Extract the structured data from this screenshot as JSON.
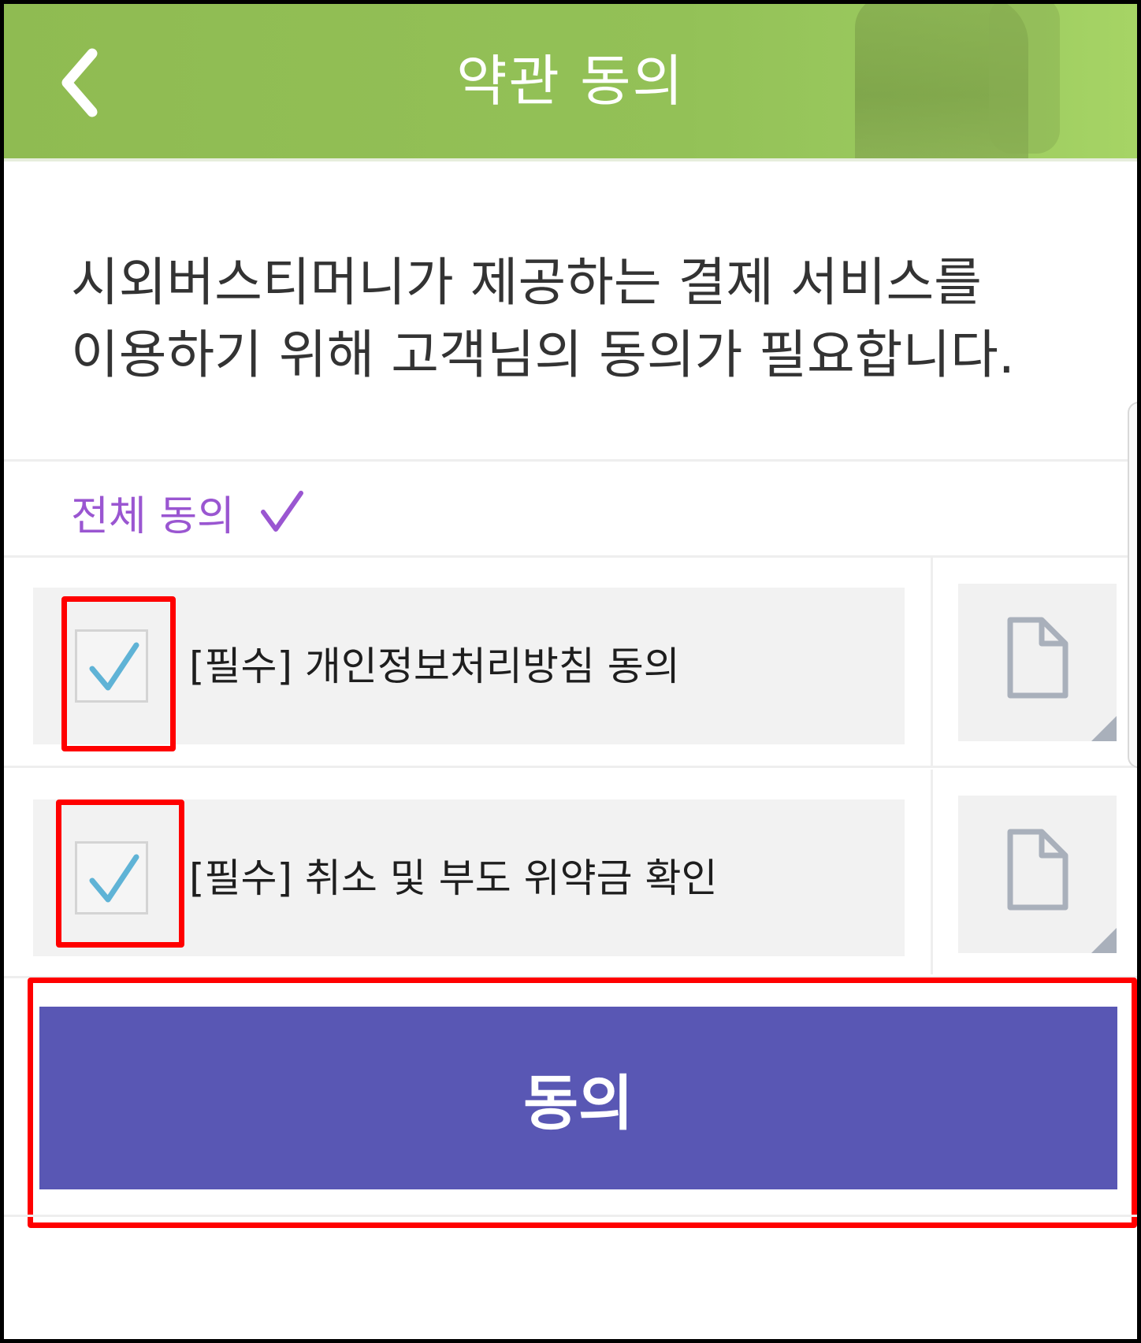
{
  "header": {
    "title": "약관 동의",
    "back_icon": "chevron-left-icon",
    "colors": {
      "background": "#93c157",
      "text": "#ffffff"
    }
  },
  "description": {
    "line1": "시외버스티머니가 제공하는 결제 서비스를",
    "line2": "이용하기 위해 고객님의 동의가 필요합니다."
  },
  "all_agree": {
    "label": "전체 동의",
    "icon": "checkmark-icon",
    "color": "#9a56d1"
  },
  "terms": [
    {
      "label": "[필수] 개인정보처리방침 동의",
      "checked": true,
      "doc_icon": "document-icon"
    },
    {
      "label": "[필수] 취소 및 부도 위약금 확인",
      "checked": true,
      "doc_icon": "document-icon"
    }
  ],
  "agree_button": {
    "label": "동의",
    "color": "#5957b4"
  },
  "highlight_color": "#ff0000"
}
